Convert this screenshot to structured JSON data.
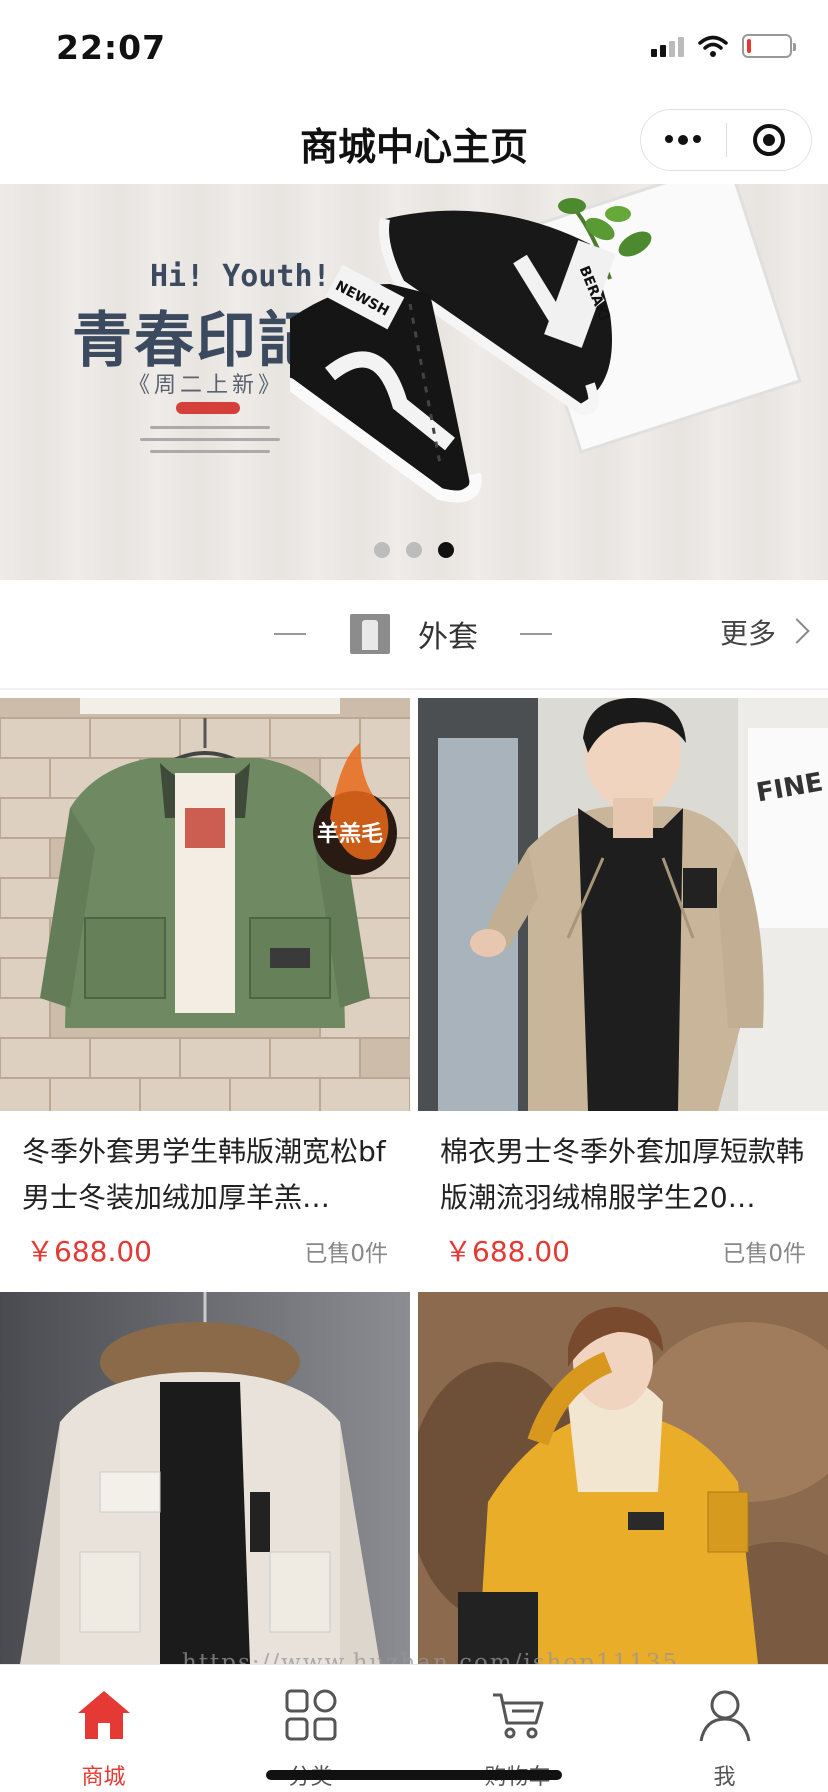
{
  "status_bar": {
    "time": "22:07"
  },
  "nav": {
    "title": "商城中心主页"
  },
  "banner": {
    "tagline": "Hi! Youth!",
    "headline": "青春印記",
    "subline": "《周二上新》",
    "shoe_text_left": "NEWSH",
    "shoe_text_right": "BERAKI",
    "page_count": 3,
    "active_page": 3
  },
  "section": {
    "title": "外套",
    "more_label": "更多"
  },
  "products": [
    {
      "name": "冬季外套男学生韩版潮宽松bf男士冬装加绒加厚羊羔…",
      "price": "￥688.00",
      "sold": "已售0件",
      "badge": "羊羔毛"
    },
    {
      "name": "棉衣男士冬季外套加厚短款韩版潮流羽绒棉服学生20…",
      "price": "￥688.00",
      "sold": "已售0件",
      "sign": "FINE"
    },
    {
      "name": "",
      "price": "",
      "sold": ""
    },
    {
      "name": "",
      "price": "",
      "sold": ""
    }
  ],
  "watermark": "https://www.huzhan.com/ishop11135",
  "tabs": [
    {
      "label": "商城",
      "icon": "home-icon",
      "active": true
    },
    {
      "label": "分类",
      "icon": "category-grid-icon",
      "active": false
    },
    {
      "label": "购物车",
      "icon": "cart-icon",
      "active": false
    },
    {
      "label": "我",
      "icon": "user-icon",
      "active": false
    }
  ],
  "colors": {
    "accent": "#e53935",
    "banner_text": "#3b4a5e"
  }
}
